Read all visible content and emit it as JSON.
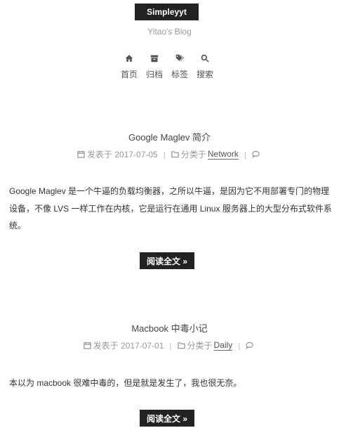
{
  "site": {
    "brand": "Simpleyyt",
    "subtitle": "Yitao's Blog"
  },
  "nav": [
    {
      "label": "首页",
      "icon": "home-icon"
    },
    {
      "label": "归档",
      "icon": "archive-icon"
    },
    {
      "label": "标签",
      "icon": "tags-icon"
    },
    {
      "label": "搜索",
      "icon": "search-icon"
    }
  ],
  "posts": [
    {
      "title": "Google Maglev 简介",
      "posted_label": "发表于",
      "date": "2017-07-05",
      "category_label": "分类于",
      "category": "Network",
      "body": "Google Maglev 是一个牛逼的负载均衡器，之所以牛逼，是因为它不用部署专门的物理设备，不像 LVS 一样工作在内核，它是运行在通用 Linux 服务器上的大型分布式软件系统。",
      "read_more": "阅读全文 »"
    },
    {
      "title": "Macbook 中毒小记",
      "posted_label": "发表于",
      "date": "2017-07-01",
      "category_label": "分类于",
      "category": "Daily",
      "body": "本以为 macbook 很难中毒的，但是就是发生了，我也很无奈。",
      "read_more": "阅读全文 »"
    }
  ]
}
